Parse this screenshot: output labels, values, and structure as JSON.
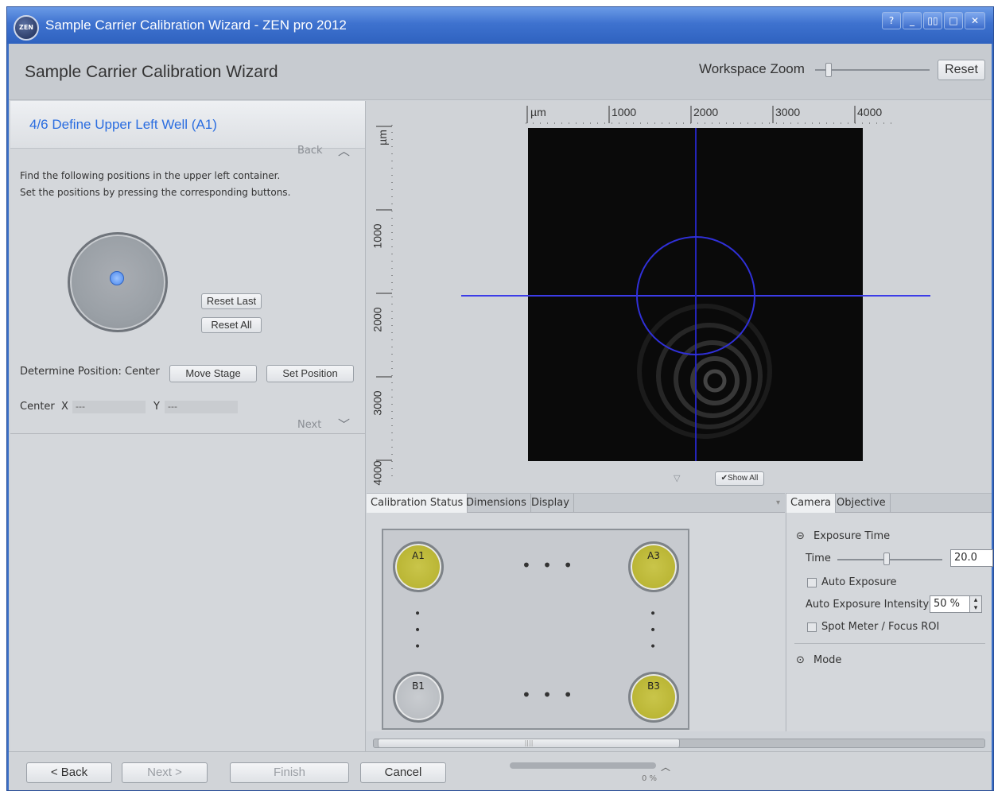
{
  "window": {
    "app_icon_text": "ZEN",
    "title": "Sample Carrier Calibration Wizard - ZEN pro 2012",
    "buttons": {
      "help": "?",
      "minimize": "_",
      "restore": "▯▯",
      "maximize": "□",
      "close": "✕"
    }
  },
  "header": {
    "title": "Sample Carrier Calibration Wizard",
    "zoom_label": "Workspace Zoom",
    "reset_label": "Reset"
  },
  "step": {
    "title": "4/6  Define Upper Left Well (A1)",
    "back_label": "Back",
    "next_label": "Next",
    "instruction_line1": "Find the following positions in the upper left container.",
    "instruction_line2": "Set the positions by pressing the corresponding buttons.",
    "reset_last_label": "Reset Last",
    "reset_all_label": "Reset All",
    "determine_label": "Determine Position: Center",
    "move_stage_label": "Move Stage",
    "set_position_label": "Set Position",
    "center_label": "Center",
    "x_label": "X",
    "y_label": "Y",
    "x_value": "---",
    "y_value": "---"
  },
  "image_view": {
    "ruler_unit": "µm",
    "ruler_h_ticks": [
      "1000",
      "2000",
      "3000",
      "4000"
    ],
    "ruler_v_ticks": [
      "1000",
      "2000",
      "3000",
      "4000"
    ],
    "show_all_label": "✔Show All",
    "expand_icon": "▽"
  },
  "calibration_tabs": {
    "tabs": [
      "Calibration Status",
      "Dimensions",
      "Display"
    ],
    "active": "Calibration Status",
    "wells": {
      "a1": "A1",
      "a3": "A3",
      "b1": "B1",
      "b3": "B3"
    },
    "ellipsis": "• • •",
    "calibrated_color": "#b3ae2a",
    "uncalibrated_color": "#b4b8bd"
  },
  "camera_panel": {
    "tabs": [
      "Camera",
      "Objective"
    ],
    "exposure_section": "Exposure Time",
    "time_label": "Time",
    "time_value": "20.0",
    "auto_exposure_label": "Auto Exposure",
    "auto_exposure_checked": false,
    "intensity_label": "Auto Exposure Intensity",
    "intensity_value": "50 %",
    "spot_meter_label": "Spot Meter / Focus ROI",
    "spot_meter_checked": false,
    "mode_label": "Mode"
  },
  "footer": {
    "back_label": "< Back",
    "next_label": "Next >",
    "finish_label": "Finish",
    "cancel_label": "Cancel",
    "progress_text": "0 %",
    "progress_value": 0
  }
}
